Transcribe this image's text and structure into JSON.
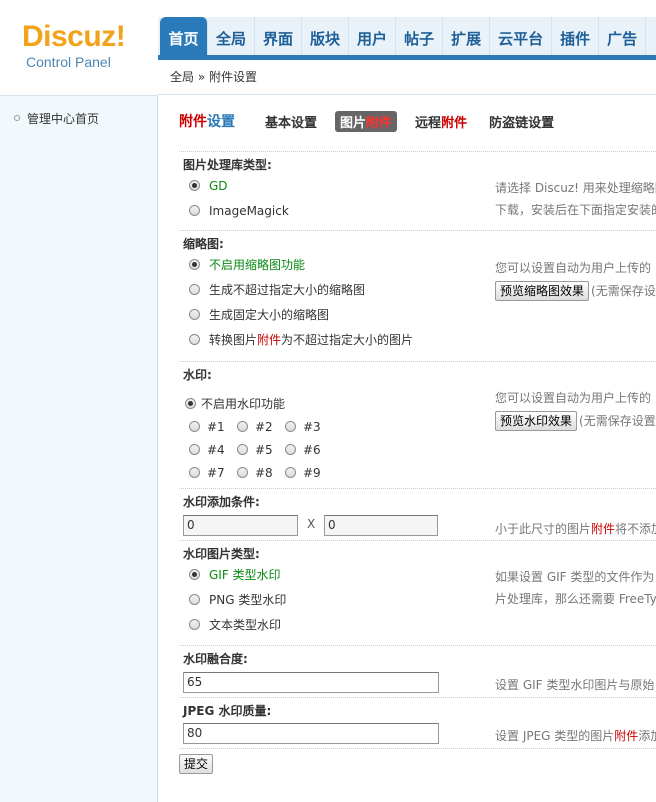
{
  "logo": {
    "main": "Discuz!",
    "sub": "Control Panel"
  },
  "nav": [
    "首页",
    "全局",
    "界面",
    "版块",
    "用户",
    "帖子",
    "扩展",
    "云平台",
    "插件",
    "广告"
  ],
  "breadcrumb": "全局 » 附件设置",
  "sidebar": {
    "items": [
      "管理中心首页"
    ]
  },
  "tabs": {
    "title_red": "附件",
    "title_blue": "设置",
    "items": [
      {
        "a": "基本设置",
        "b": ""
      },
      {
        "a": "图片",
        "b": "附件"
      },
      {
        "a": "远程",
        "b": "附件"
      },
      {
        "a": "防盗链设置",
        "b": ""
      }
    ]
  },
  "image_lib": {
    "title": "图片处理库类型:",
    "options": [
      "GD",
      "ImageMagick"
    ],
    "tip1": "请选择 Discuz! 用来处理缩略图",
    "tip2": "下载，安装后在下面指定安装的"
  },
  "thumb": {
    "title": "缩略图:",
    "opt1": "不启用缩略图功能",
    "opt2": "生成不超过指定大小的缩略图",
    "opt3": "生成固定大小的缩略图",
    "opt4_a": "转换图片",
    "opt4_b": "附件",
    "opt4_c": "为不超过指定大小的图片",
    "tip": "您可以设置自动为用户上传的",
    "button": "预览缩略图效果",
    "btn_note": "(无需保存设"
  },
  "watermark": {
    "title": "水印:",
    "opt_off": "不启用水印功能",
    "positions": [
      "#1",
      "#2",
      "#3",
      "#4",
      "#5",
      "#6",
      "#7",
      "#8",
      "#9"
    ],
    "tip": "您可以设置自动为用户上传的",
    "button": "预览水印效果",
    "btn_note": "(无需保存设置"
  },
  "wm_condition": {
    "title": "水印添加条件:",
    "width": "0",
    "sep": "X",
    "height": "0",
    "tip_a": "小于此尺寸的图片",
    "tip_b": "附件",
    "tip_c": "将不添加"
  },
  "wm_type": {
    "title": "水印图片类型:",
    "opt1": "GIF 类型水印",
    "opt2": "PNG 类型水印",
    "opt3": "文本类型水印",
    "tip1": "如果设置 GIF 类型的文件作为",
    "tip2": "片处理库，那么还需要 FreeTy"
  },
  "wm_trans": {
    "title": "水印融合度:",
    "value": "65",
    "tip": "设置 GIF 类型水印图片与原始"
  },
  "jpeg": {
    "title": "JPEG 水印质量:",
    "value": "80",
    "tip_a": "设置 JPEG 类型的图片",
    "tip_b": "附件",
    "tip_c": "添加"
  },
  "submit_label": "提交"
}
